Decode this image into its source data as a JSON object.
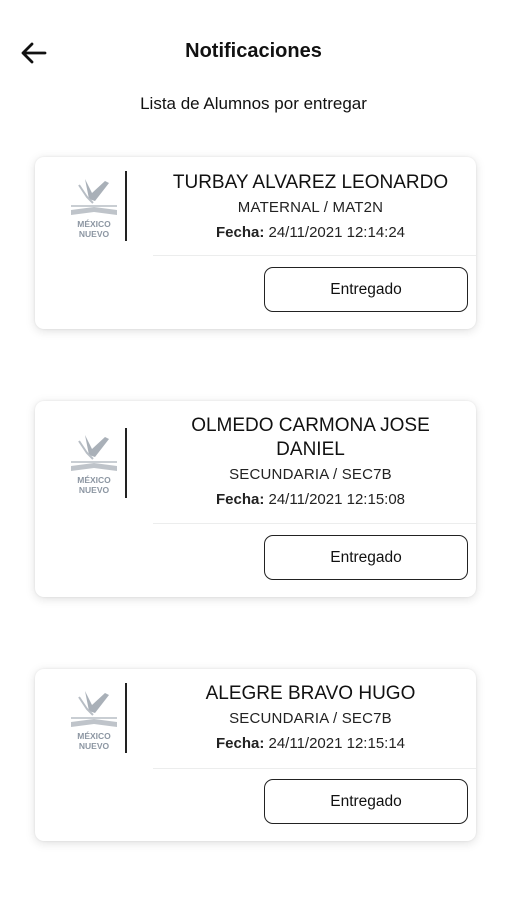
{
  "header": {
    "title": "Notificaciones",
    "back_icon": "arrow-left-icon",
    "subtitle": "Lista de Alumnos por entregar"
  },
  "logo": {
    "line1": "MÉXICO",
    "line2": "NUEVO",
    "accent_color": "#8c96a2"
  },
  "notifications": [
    {
      "name": "TURBAY ALVAREZ LEONARDO",
      "group": "MATERNAL / MAT2N",
      "date_label": "Fecha:",
      "date_value": "24/11/2021 12:14:24",
      "button_label": "Entregado"
    },
    {
      "name": "OLMEDO CARMONA JOSE DANIEL",
      "group": "SECUNDARIA / SEC7B",
      "date_label": "Fecha:",
      "date_value": "24/11/2021 12:15:08",
      "button_label": "Entregado"
    },
    {
      "name": "ALEGRE BRAVO HUGO",
      "group": "SECUNDARIA / SEC7B",
      "date_label": "Fecha:",
      "date_value": "24/11/2021 12:15:14",
      "button_label": "Entregado"
    }
  ]
}
